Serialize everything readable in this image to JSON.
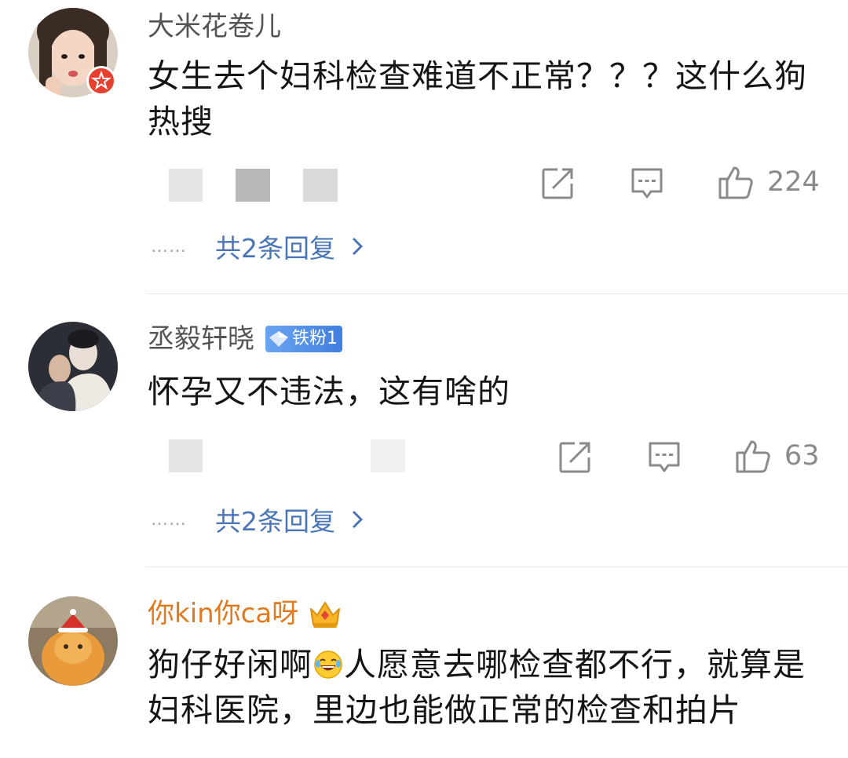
{
  "comments": [
    {
      "username": "大米花卷儿",
      "text": "女生去个妇科检查难道不正常？？？这什么狗热搜",
      "likes": "224",
      "replies_label": "共2条回复",
      "dots": "……"
    },
    {
      "username": "丞毅轩晓",
      "fan_badge": "铁粉1",
      "text": "怀孕又不违法，这有啥的",
      "likes": "63",
      "replies_label": "共2条回复",
      "dots": "……"
    },
    {
      "username": "你kin你ca呀",
      "text_before_emoji": "狗仔好闲啊",
      "text_after_emoji": "人愿意去哪检查都不行，就算是妇科医院，里边也能做正常的检查和拍片"
    }
  ],
  "icons": {
    "share": "share-icon",
    "comment": "comment-icon",
    "like": "thumbs-up-icon",
    "chevron": "chevron-right-icon",
    "verified": "verified-star-icon",
    "gem": "diamond-icon",
    "crown": "crown-icon",
    "laugh": "laughing-tears-emoji"
  },
  "colors": {
    "link": "#4a76b8",
    "username": "#555555",
    "gold_username": "#e07a1f",
    "fan_badge": "#4f8ae8",
    "verified": "#e8402f"
  }
}
